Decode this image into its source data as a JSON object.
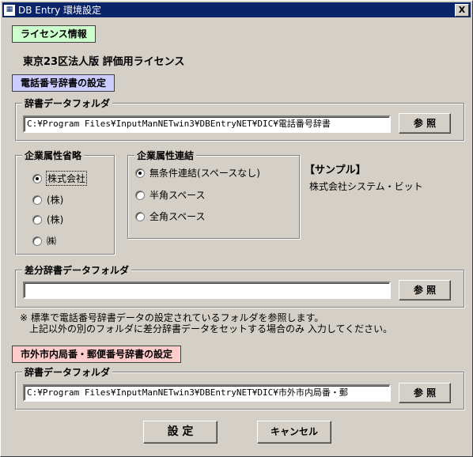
{
  "window": {
    "title": "DB Entry 環境設定",
    "close_glyph": "X",
    "icon": "app-icon"
  },
  "license": {
    "header": "ライセンス情報",
    "text": "東京23区法人版 評価用ライセンス"
  },
  "phone_dict": {
    "header": "電話番号辞書の設定",
    "folder_group": "辞書データフォルダ",
    "folder_value": "C:¥Program Files¥InputManNETwin3¥DBEntryNET¥DIC¥電話番号辞書",
    "browse_label": "参 照"
  },
  "company_abbrev": {
    "group": "企業属性省略",
    "options": [
      "株式会社",
      "(株)",
      "(株)",
      "㈱"
    ],
    "selected": 0
  },
  "company_link": {
    "group": "企業属性連結",
    "options": [
      "無条件連結(スペースなし)",
      "半角スペース",
      "全角スペース"
    ],
    "selected": 0
  },
  "sample": {
    "title": "【サンプル】",
    "value": "株式会社システム・ビット"
  },
  "diff_dict": {
    "group": "差分辞書データフォルダ",
    "folder_value": "",
    "browse_label": "参 照",
    "note_line1": "※ 標準で電話番号辞書データの設定されているフォルダを参照します。",
    "note_line2": "上記以外の別のフォルダに差分辞書データをセットする場合のみ 入力してください。"
  },
  "postal_dict": {
    "header": "市外市内局番・郵便番号辞書の設定",
    "folder_group": "辞書データフォルダ",
    "folder_value": "C:¥Program Files¥InputManNETwin3¥DBEntryNET¥DIC¥市外市内局番・郵",
    "browse_label": "参 照"
  },
  "footer": {
    "ok_label": "設 定",
    "cancel_label": "キャンセル"
  },
  "colors": {
    "title_bar": "#0a246a",
    "license_badge": "#ccffcc",
    "phone_badge": "#ccccff",
    "postal_badge": "#ffcccc",
    "dialog_bg": "#d4d0c8"
  }
}
